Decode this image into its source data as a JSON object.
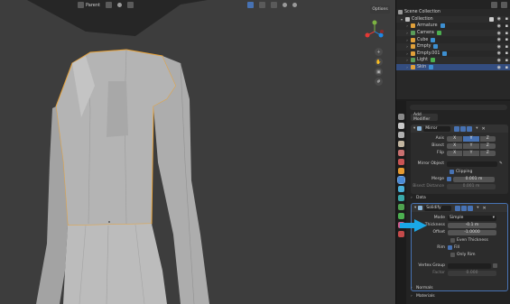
{
  "viewport": {
    "mode_label": "Parent",
    "options_label": "Options"
  },
  "outliner": {
    "scene_collection": "Scene Collection",
    "collection": "Collection",
    "items": [
      {
        "label": "Armature",
        "color": "#e0a03a"
      },
      {
        "label": "Camera",
        "color": "#5a9d5a"
      },
      {
        "label": "Cube",
        "color": "#e0a03a"
      },
      {
        "label": "Empty",
        "color": "#e0a03a"
      },
      {
        "label": "Empty.001",
        "color": "#e0a03a"
      },
      {
        "label": "Light",
        "color": "#5a9d5a"
      },
      {
        "label": "Skin",
        "color": "#e0a03a",
        "selected": true
      }
    ]
  },
  "properties": {
    "add_modifier": "Add Modifier",
    "mirror": {
      "name": "Mirror",
      "axis_label": "Axis",
      "bisect_label": "Bisect",
      "flip_label": "Flip",
      "x": "X",
      "y": "Y",
      "z": "Z",
      "mirror_object_label": "Mirror Object",
      "clipping_label": "Clipping",
      "merge_label": "Merge",
      "merge_value": "0.001 m",
      "bisect_distance_label": "Bisect Distance",
      "bisect_distance_value": "0.001 m",
      "data_label": "Data"
    },
    "solidify": {
      "name": "Solidify",
      "mode_label": "Mode",
      "mode_value": "Simple",
      "thickness_label": "Thickness",
      "thickness_value": "-0.1 m",
      "offset_label": "Offset",
      "offset_value": "-1.0000",
      "even_thickness_label": "Even Thickness",
      "rim_label": "Rim",
      "fill_label": "Fill",
      "only_rim_label": "Only Rim",
      "vertex_group_label": "Vertex Group",
      "factor_label": "Factor",
      "factor_value": "0.000",
      "normals_label": "Normals",
      "materials_label": "Materials"
    }
  },
  "colors": {
    "accent_blue": "#4772b3",
    "selection_outline": "#e8a33a",
    "annotation_arrow": "#1aa7e6"
  }
}
